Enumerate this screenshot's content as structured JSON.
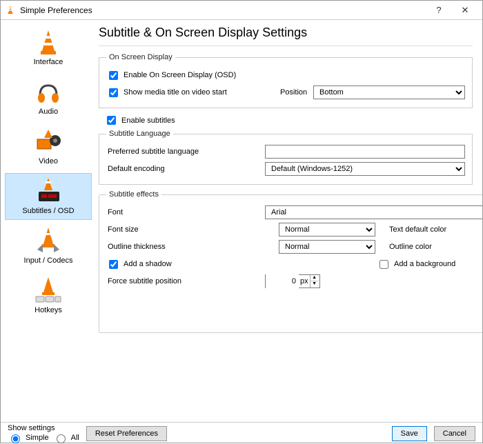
{
  "window": {
    "title": "Simple Preferences"
  },
  "sidebar": {
    "items": [
      {
        "label": "Interface"
      },
      {
        "label": "Audio"
      },
      {
        "label": "Video"
      },
      {
        "label": "Subtitles / OSD"
      },
      {
        "label": "Input / Codecs"
      },
      {
        "label": "Hotkeys"
      }
    ]
  },
  "page": {
    "title": "Subtitle & On Screen Display Settings"
  },
  "osd": {
    "group_title": "On Screen Display",
    "enable_osd_label": "Enable On Screen Display (OSD)",
    "enable_osd_checked": true,
    "show_title_label": "Show media title on video start",
    "show_title_checked": true,
    "position_label": "Position",
    "position_value": "Bottom"
  },
  "subtitles": {
    "enable_label": "Enable subtitles",
    "enable_checked": true,
    "lang_group_title": "Subtitle Language",
    "preferred_label": "Preferred subtitle language",
    "preferred_value": "",
    "encoding_label": "Default encoding",
    "encoding_value": "Default (Windows-1252)"
  },
  "effects": {
    "group_title": "Subtitle effects",
    "font_label": "Font",
    "font_value": "Arial",
    "font_size_label": "Font size",
    "font_size_value": "Normal",
    "text_color_label": "Text default color",
    "text_color": "#ffffff",
    "outline_thick_label": "Outline thickness",
    "outline_thick_value": "Normal",
    "outline_color_label": "Outline color",
    "outline_color": "#000000",
    "shadow_label": "Add a shadow",
    "shadow_checked": true,
    "background_label": "Add a background",
    "background_checked": false,
    "force_pos_label": "Force subtitle position",
    "force_pos_value": "0",
    "force_pos_unit": "px"
  },
  "footer": {
    "show_settings_label": "Show settings",
    "simple_label": "Simple",
    "all_label": "All",
    "mode": "simple",
    "reset_label": "Reset Preferences",
    "save_label": "Save",
    "cancel_label": "Cancel"
  }
}
